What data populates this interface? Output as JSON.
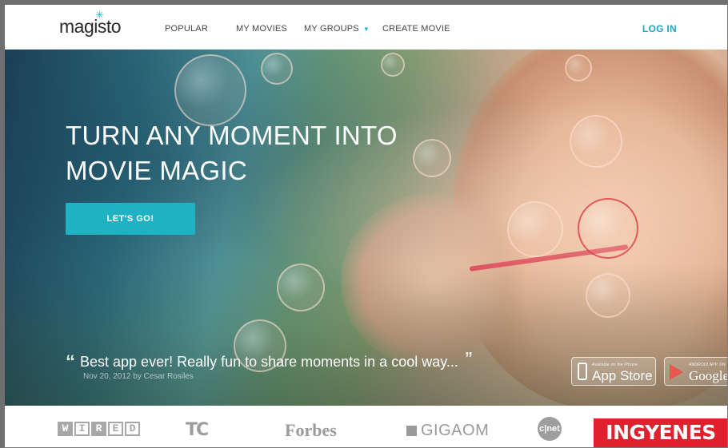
{
  "nav": {
    "logo": "magisto",
    "items": [
      {
        "label": "POPULAR"
      },
      {
        "label": "MY MOVIES"
      },
      {
        "label": "MY GROUPS"
      },
      {
        "label": "CREATE MOVIE"
      }
    ],
    "login_label": "LOG IN"
  },
  "hero": {
    "headline_line1": "TURN ANY MOMENT INTO",
    "headline_line2": "MOVIE MAGIC",
    "cta_label": "LET'S GO!",
    "quote_text": "Best app ever! Really fun to share moments in a cool way...",
    "quote_meta": "Nov 20, 2012  by Cesar Rosiles",
    "stores": {
      "appstore_small": "Available on the iPhone",
      "appstore_big": "App Store",
      "gplay_small": "ANDROID APP ON",
      "gplay_big": "Google pl"
    }
  },
  "press": {
    "wired_letters": [
      "W",
      "I",
      "R",
      "E",
      "D"
    ],
    "techcrunch": "TC",
    "forbes": "Forbes",
    "gigaom": "GIGAOM",
    "cnet": "c|net",
    "banner": "INGYENES"
  },
  "colors": {
    "accent": "#1fb2c4",
    "login": "#1fa6be",
    "banner": "#e0202c"
  }
}
